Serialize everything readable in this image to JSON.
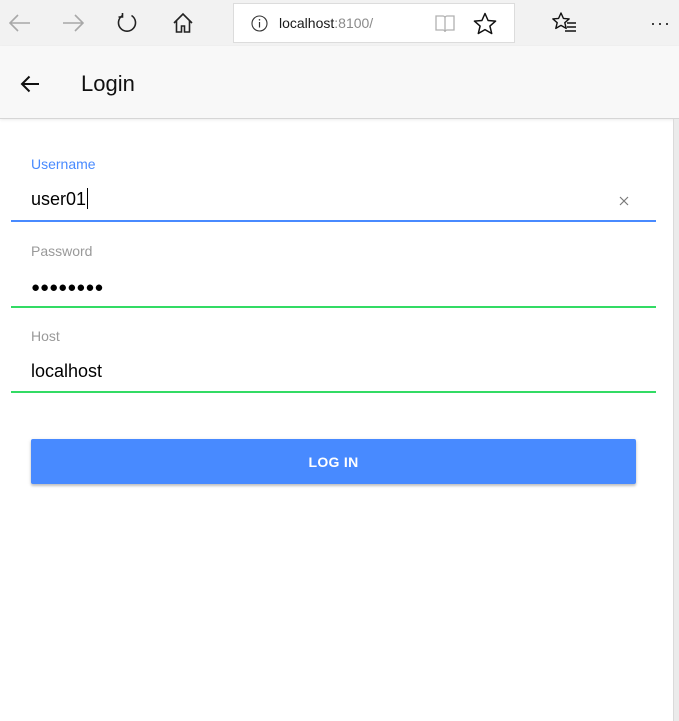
{
  "browser": {
    "back_icon": "arrow-left-icon",
    "forward_icon": "arrow-right-icon",
    "refresh_icon": "refresh-icon",
    "home_icon": "home-icon",
    "address": {
      "host": "localhost",
      "port_path": ":8100/",
      "info_icon": "info-icon",
      "reading_view_icon": "book-icon",
      "favorite_icon": "star-icon"
    },
    "favorites_icon": "favorites-list-icon",
    "more_icon": "more-icon",
    "more_label": "···"
  },
  "header": {
    "title": "Login",
    "back_icon": "arrow-left-icon"
  },
  "form": {
    "username": {
      "label": "Username",
      "value": "user01",
      "state": "focused",
      "clear_icon": "close-icon"
    },
    "password": {
      "label": "Password",
      "value_masked": "●●●●●●●●",
      "state": "valid"
    },
    "host": {
      "label": "Host",
      "value": "localhost",
      "state": "valid"
    },
    "submit_label": "LOG IN"
  },
  "colors": {
    "primary": "#488aff",
    "valid": "#32db64",
    "label_gray": "#999999",
    "header_bg": "#f8f8f8"
  }
}
